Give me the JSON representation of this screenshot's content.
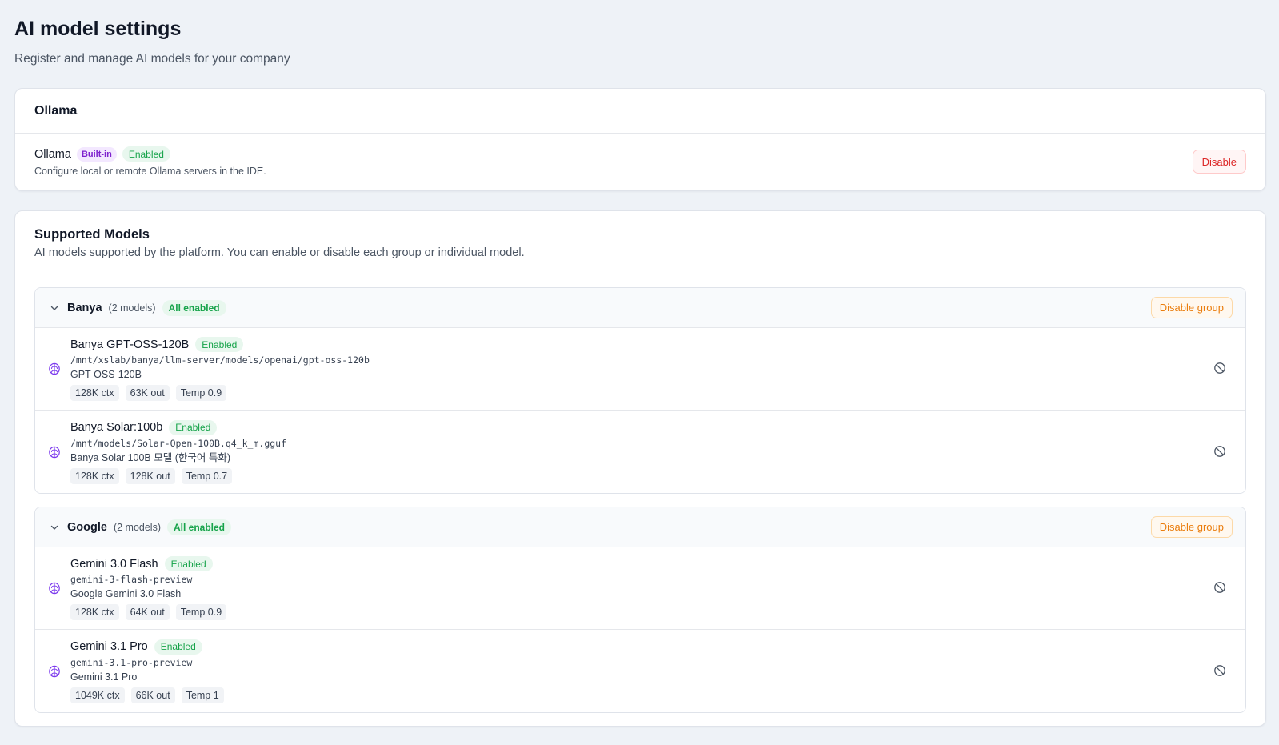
{
  "page": {
    "title": "AI model settings",
    "subtitle": "Register and manage AI models for your company"
  },
  "ollama": {
    "section_title": "Ollama",
    "name": "Ollama",
    "builtin_badge": "Built-in",
    "status_badge": "Enabled",
    "description": "Configure local or remote Ollama servers in the IDE.",
    "disable_label": "Disable"
  },
  "supported": {
    "title": "Supported Models",
    "description": "AI models supported by the platform. You can enable or disable each group or individual model.",
    "groups": [
      {
        "name": "Banya",
        "count": "(2 models)",
        "status": "All enabled",
        "action": "Disable group",
        "models": [
          {
            "name": "Banya GPT-OSS-120B",
            "status": "Enabled",
            "path": "/mnt/xslab/banya/llm-server/models/openai/gpt-oss-120b",
            "display": "GPT-OSS-120B",
            "chips": [
              "128K ctx",
              "63K out",
              "Temp 0.9"
            ]
          },
          {
            "name": "Banya Solar:100b",
            "status": "Enabled",
            "path": "/mnt/models/Solar-Open-100B.q4_k_m.gguf",
            "display": "Banya Solar 100B 모델 (한국어 특화)",
            "chips": [
              "128K ctx",
              "128K out",
              "Temp 0.7"
            ]
          }
        ]
      },
      {
        "name": "Google",
        "count": "(2 models)",
        "status": "All enabled",
        "action": "Disable group",
        "models": [
          {
            "name": "Gemini 3.0 Flash",
            "status": "Enabled",
            "path": "gemini-3-flash-preview",
            "display": "Google Gemini 3.0 Flash",
            "chips": [
              "128K ctx",
              "64K out",
              "Temp 0.9"
            ]
          },
          {
            "name": "Gemini 3.1 Pro",
            "status": "Enabled",
            "path": "gemini-3.1-pro-preview",
            "display": "Gemini 3.1 Pro",
            "chips": [
              "1049K ctx",
              "66K out",
              "Temp 1"
            ]
          }
        ]
      }
    ]
  },
  "icons": {
    "chevron": "chevron-down-icon",
    "model": "brain-icon",
    "disable_model": "ban-icon"
  },
  "colors": {
    "background": "#eef2f7",
    "enabled_green": "#16a34a",
    "builtin_purple": "#7e22ce",
    "danger_red": "#dc2626",
    "warning_orange": "#ea7c0c",
    "model_icon_purple": "#7c3aed"
  }
}
